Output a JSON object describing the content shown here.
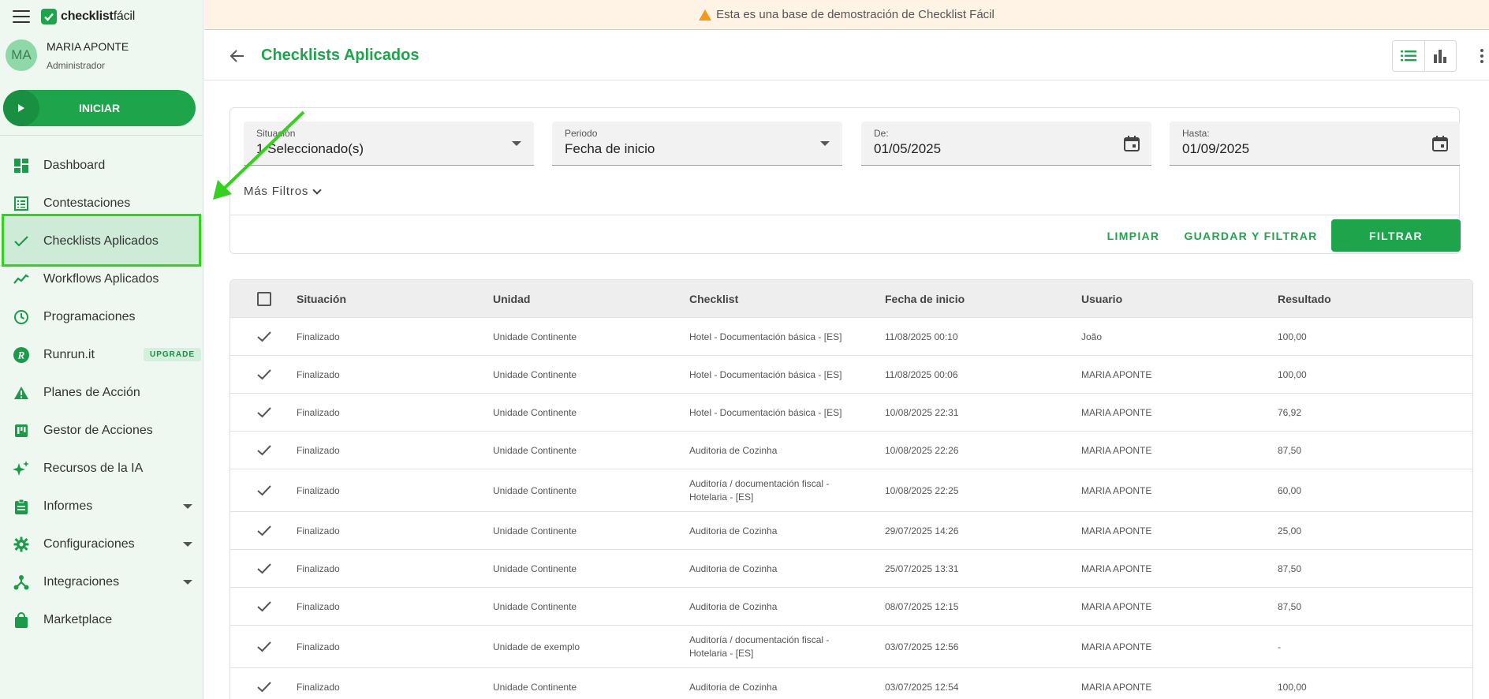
{
  "app": {
    "logo_bold": "checklist",
    "logo_rest": "fácil",
    "user_initials": "MA",
    "user_name": "MARIA APONTE",
    "user_role": "Administrador",
    "start_label": "INICIAR",
    "brand_color": "#1ea54c"
  },
  "banner": {
    "text": "Esta es una base de demostración de Checklist Fácil",
    "icon": "warning-icon"
  },
  "sidebar": {
    "items": [
      {
        "label": "Dashboard",
        "icon": "dashboard-icon"
      },
      {
        "label": "Contestaciones",
        "icon": "list-icon"
      },
      {
        "label": "Checklists Aplicados",
        "icon": "check-icon",
        "active": true
      },
      {
        "label": "Workflows Aplicados",
        "icon": "trend-icon"
      },
      {
        "label": "Programaciones",
        "icon": "clock-icon"
      },
      {
        "label": "Runrun.it",
        "icon": "runrun-icon",
        "badge": "UPGRADE"
      },
      {
        "label": "Planes de Acción",
        "icon": "alert-icon"
      },
      {
        "label": "Gestor de Acciones",
        "icon": "board-icon"
      },
      {
        "label": "Recursos de la IA",
        "icon": "sparkle-icon"
      },
      {
        "label": "Informes",
        "icon": "clipboard-icon",
        "expandable": true
      },
      {
        "label": "Configuraciones",
        "icon": "gear-icon",
        "expandable": true
      },
      {
        "label": "Integraciones",
        "icon": "network-icon",
        "expandable": true
      },
      {
        "label": "Marketplace",
        "icon": "bag-icon"
      }
    ]
  },
  "header": {
    "title": "Checklists Aplicados"
  },
  "filters": {
    "situacion": {
      "label": "Situación",
      "value": "1 Seleccionado(s)"
    },
    "periodo": {
      "label": "Periodo",
      "value": "Fecha de inicio"
    },
    "de": {
      "label": "De:",
      "value": "01/05/2025"
    },
    "hasta": {
      "label": "Hasta:",
      "value": "01/09/2025"
    },
    "more_filters": "Más Filtros",
    "clear": "LIMPIAR",
    "save_filter": "GUARDAR Y FILTRAR",
    "filter": "FILTRAR"
  },
  "table": {
    "columns": [
      "Situación",
      "Unidad",
      "Checklist",
      "Fecha de inicio",
      "Usuario",
      "Resultado"
    ],
    "rows": [
      {
        "situacion": "Finalizado",
        "unidad": "Unidade Continente",
        "checklist": [
          "Hotel - Documentación básica - [ES]"
        ],
        "fecha": "11/08/2025 00:10",
        "usuario": "João",
        "resultado": "100,00"
      },
      {
        "situacion": "Finalizado",
        "unidad": "Unidade Continente",
        "checklist": [
          "Hotel - Documentación básica - [ES]"
        ],
        "fecha": "11/08/2025 00:06",
        "usuario": "MARIA APONTE",
        "resultado": "100,00"
      },
      {
        "situacion": "Finalizado",
        "unidad": "Unidade Continente",
        "checklist": [
          "Hotel - Documentación básica - [ES]"
        ],
        "fecha": "10/08/2025 22:31",
        "usuario": "MARIA APONTE",
        "resultado": "76,92"
      },
      {
        "situacion": "Finalizado",
        "unidad": "Unidade Continente",
        "checklist": [
          "Auditoria de Cozinha"
        ],
        "fecha": "10/08/2025 22:26",
        "usuario": "MARIA APONTE",
        "resultado": "87,50"
      },
      {
        "situacion": "Finalizado",
        "unidad": "Unidade Continente",
        "checklist": [
          "Auditoría / documentación fiscal -",
          "Hotelaria - [ES]"
        ],
        "fecha": "10/08/2025 22:25",
        "usuario": "MARIA APONTE",
        "resultado": "60,00"
      },
      {
        "situacion": "Finalizado",
        "unidad": "Unidade Continente",
        "checklist": [
          "Auditoria de Cozinha"
        ],
        "fecha": "29/07/2025 14:26",
        "usuario": "MARIA APONTE",
        "resultado": "25,00"
      },
      {
        "situacion": "Finalizado",
        "unidad": "Unidade Continente",
        "checklist": [
          "Auditoria de Cozinha"
        ],
        "fecha": "25/07/2025 13:31",
        "usuario": "MARIA APONTE",
        "resultado": "87,50"
      },
      {
        "situacion": "Finalizado",
        "unidad": "Unidade Continente",
        "checklist": [
          "Auditoria de Cozinha"
        ],
        "fecha": "08/07/2025 12:15",
        "usuario": "MARIA APONTE",
        "resultado": "87,50"
      },
      {
        "situacion": "Finalizado",
        "unidad": "Unidade de exemplo",
        "checklist": [
          "Auditoría / documentación fiscal -",
          "Hotelaria - [ES]"
        ],
        "fecha": "03/07/2025 12:56",
        "usuario": "MARIA APONTE",
        "resultado": "-"
      },
      {
        "situacion": "Finalizado",
        "unidad": "Unidade Continente",
        "checklist": [
          "Auditoria de Cozinha"
        ],
        "fecha": "03/07/2025 12:54",
        "usuario": "MARIA APONTE",
        "resultado": "100,00"
      }
    ]
  }
}
